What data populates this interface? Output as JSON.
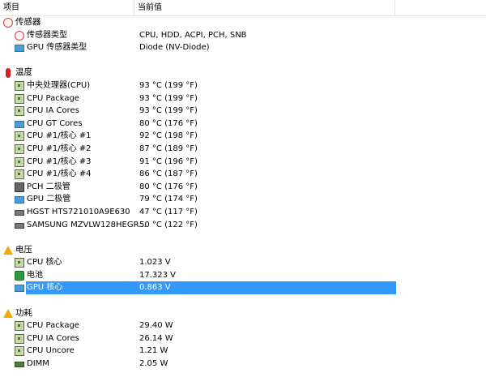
{
  "header": {
    "col_item": "项目",
    "col_value": "当前值"
  },
  "groups": [
    {
      "label": "传感器",
      "icon": "sensor-icon",
      "rows": [
        {
          "name": "传感器类型",
          "value": "CPU, HDD, ACPI, PCH, SNB",
          "icon": "sensor-type-icon"
        },
        {
          "name": "GPU 传感器类型",
          "value": "Diode  (NV-Diode)",
          "icon": "gpu-icon"
        }
      ]
    },
    {
      "label": "温度",
      "icon": "thermometer-icon",
      "rows": [
        {
          "name": "中央处理器(CPU)",
          "value": "93 °C  (199 °F)",
          "icon": "cpu-chip-icon"
        },
        {
          "name": "CPU Package",
          "value": "93 °C  (199 °F)",
          "icon": "cpu-chip-icon"
        },
        {
          "name": "CPU IA Cores",
          "value": "93 °C  (199 °F)",
          "icon": "cpu-chip-icon"
        },
        {
          "name": "CPU GT Cores",
          "value": "80 °C  (176 °F)",
          "icon": "gpu-icon"
        },
        {
          "name": "CPU #1/核心 #1",
          "value": "92 °C  (198 °F)",
          "icon": "cpu-chip-icon"
        },
        {
          "name": "CPU #1/核心 #2",
          "value": "87 °C  (189 °F)",
          "icon": "cpu-chip-icon"
        },
        {
          "name": "CPU #1/核心 #3",
          "value": "91 °C  (196 °F)",
          "icon": "cpu-chip-icon"
        },
        {
          "name": "CPU #1/核心 #4",
          "value": "86 °C  (187 °F)",
          "icon": "cpu-chip-icon"
        },
        {
          "name": "PCH 二极管",
          "value": "80 °C  (176 °F)",
          "icon": "pch-icon"
        },
        {
          "name": "GPU 二极管",
          "value": "79 °C  (174 °F)",
          "icon": "gpu-icon"
        },
        {
          "name": "HGST HTS721010A9E630",
          "value": "47 °C  (117 °F)",
          "icon": "hdd-icon"
        },
        {
          "name": "SAMSUNG MZVLW128HEGR...",
          "value": "50 °C  (122 °F)",
          "icon": "hdd-icon"
        }
      ]
    },
    {
      "label": "电压",
      "icon": "warning-icon",
      "rows": [
        {
          "name": "CPU 核心",
          "value": "1.023 V",
          "icon": "cpu-chip-icon"
        },
        {
          "name": "电池",
          "value": "17.323 V",
          "icon": "battery-icon"
        },
        {
          "name": "GPU 核心",
          "value": "0.863 V",
          "icon": "gpu-icon",
          "selected": true
        }
      ]
    },
    {
      "label": "功耗",
      "icon": "warning-icon",
      "rows": [
        {
          "name": "CPU Package",
          "value": "29.40 W",
          "icon": "cpu-chip-icon"
        },
        {
          "name": "CPU IA Cores",
          "value": "26.14 W",
          "icon": "cpu-chip-icon"
        },
        {
          "name": "CPU Uncore",
          "value": "1.21 W",
          "icon": "cpu-chip-icon"
        },
        {
          "name": "DIMM",
          "value": "2.05 W",
          "icon": "dimm-icon"
        }
      ]
    }
  ]
}
